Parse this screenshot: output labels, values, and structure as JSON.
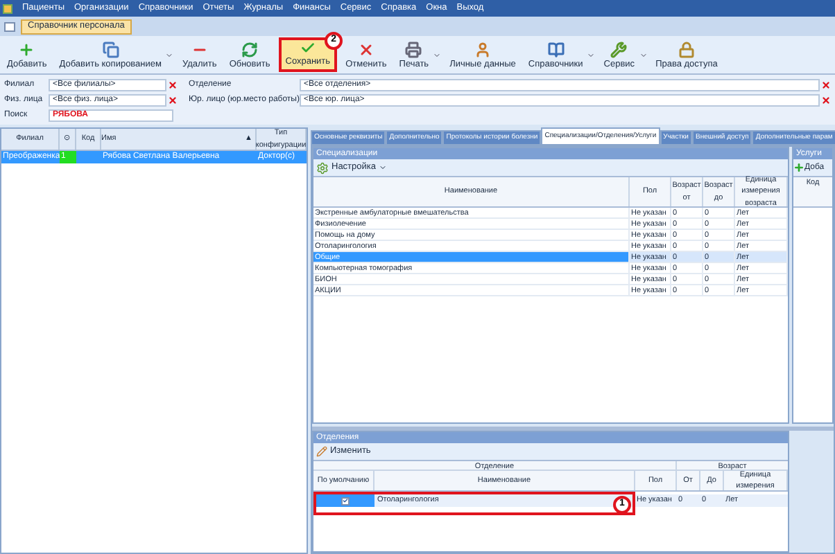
{
  "menu": [
    "Пациенты",
    "Организации",
    "Справочники",
    "Отчеты",
    "Журналы",
    "Финансы",
    "Сервис",
    "Справка",
    "Окна",
    "Выход"
  ],
  "doc_tabs": [
    {
      "label": "Справочник персонала",
      "selected": true
    }
  ],
  "toolbar": [
    {
      "label": "Добавить",
      "dropdown": false
    },
    {
      "label": "Добавить копированием",
      "dropdown": true
    },
    {
      "label": "Удалить",
      "dropdown": false
    },
    {
      "label": "Обновить",
      "dropdown": false
    },
    {
      "label": "Сохранить",
      "dropdown": false,
      "callout": "2"
    },
    {
      "label": "Отменить",
      "dropdown": false
    },
    {
      "label": "Печать",
      "dropdown": true
    },
    {
      "label": "Личные данные",
      "dropdown": false
    },
    {
      "label": "Справочники",
      "dropdown": true
    },
    {
      "label": "Сервис",
      "dropdown": true
    },
    {
      "label": "Права доступа",
      "dropdown": false
    }
  ],
  "filters_left": [
    {
      "label": "Филиал",
      "value": "<Все филиалы>"
    },
    {
      "label": "Физ. лица",
      "value": "<Все физ. лица>"
    }
  ],
  "search": {
    "label": "Поиск",
    "value": "РЯБОВА"
  },
  "filters_right": [
    {
      "label": "Отделение",
      "value": "<Все отделения>"
    },
    {
      "label": "Юр. лицо (юр.место работы)",
      "value": "<Все юр. лица>"
    }
  ],
  "staff_grid": {
    "columns": [
      "Филиал",
      "⊙",
      "Код",
      "Имя",
      "Тип конфигурации"
    ],
    "sort_mark": "▲",
    "rows": [
      {
        "branch": "Преображенка",
        "status": {
          "text": "1",
          "color": "#22dd22"
        },
        "name": "Рябова Светлана Валерьевна",
        "config": "Доктор(с)",
        "selected": true
      }
    ]
  },
  "detail_tabs": [
    {
      "label": "Основные реквизиты",
      "selected": false
    },
    {
      "label": "Дополнительно",
      "selected": false
    },
    {
      "label": "Протоколы истории болезни",
      "selected": false
    },
    {
      "label": "Специализации/Отделения/Услуги",
      "selected": true
    },
    {
      "label": "Участки",
      "selected": false
    },
    {
      "label": "Внешний доступ",
      "selected": false
    },
    {
      "label": "Дополнительные парам",
      "selected": false
    }
  ],
  "specializations": {
    "title": "Специализации",
    "tool": "Настройка",
    "columns": [
      "Наименование",
      "Пол",
      "Возраст от",
      "Возраст до",
      "Единица измерения возраста"
    ],
    "rows": [
      {
        "cells": [
          "Экстренные амбулаторные вмешательства",
          "Не указан",
          "0",
          "0",
          "Лет"
        ],
        "selected": false
      },
      {
        "cells": [
          "Физиолечение",
          "Не указан",
          "0",
          "0",
          "Лет"
        ],
        "selected": false
      },
      {
        "cells": [
          "Помощь на дому",
          "Не указан",
          "0",
          "0",
          "Лет"
        ],
        "selected": false
      },
      {
        "cells": [
          "Отоларингология",
          "Не указан",
          "0",
          "0",
          "Лет"
        ],
        "selected": false
      },
      {
        "cells": [
          "Общие",
          "Не указан",
          "0",
          "0",
          "Лет"
        ],
        "selected": true
      },
      {
        "cells": [
          "Компьютерная томография",
          "Не указан",
          "0",
          "0",
          "Лет"
        ],
        "selected": false
      },
      {
        "cells": [
          "БИОН",
          "Не указан",
          "0",
          "0",
          "Лет"
        ],
        "selected": false
      },
      {
        "cells": [
          "АКЦИИ",
          "Не указан",
          "0",
          "0",
          "Лет"
        ],
        "selected": false
      }
    ]
  },
  "services": {
    "title": "Услуги",
    "tool": "Доба",
    "columns": [
      "Код"
    ]
  },
  "departments": {
    "title": "Отделения",
    "tool": "Изменить",
    "groups": [
      "Отделение",
      "Возраст"
    ],
    "columns": [
      "По умолчанию",
      "Наименование",
      "Пол",
      "От",
      "До",
      "Единица измерения"
    ],
    "rows": [
      {
        "default": true,
        "name": "Отоларингология",
        "sex": "Не указан",
        "from": "0",
        "to": "0",
        "unit": "Лет",
        "callout": "1"
      }
    ]
  }
}
